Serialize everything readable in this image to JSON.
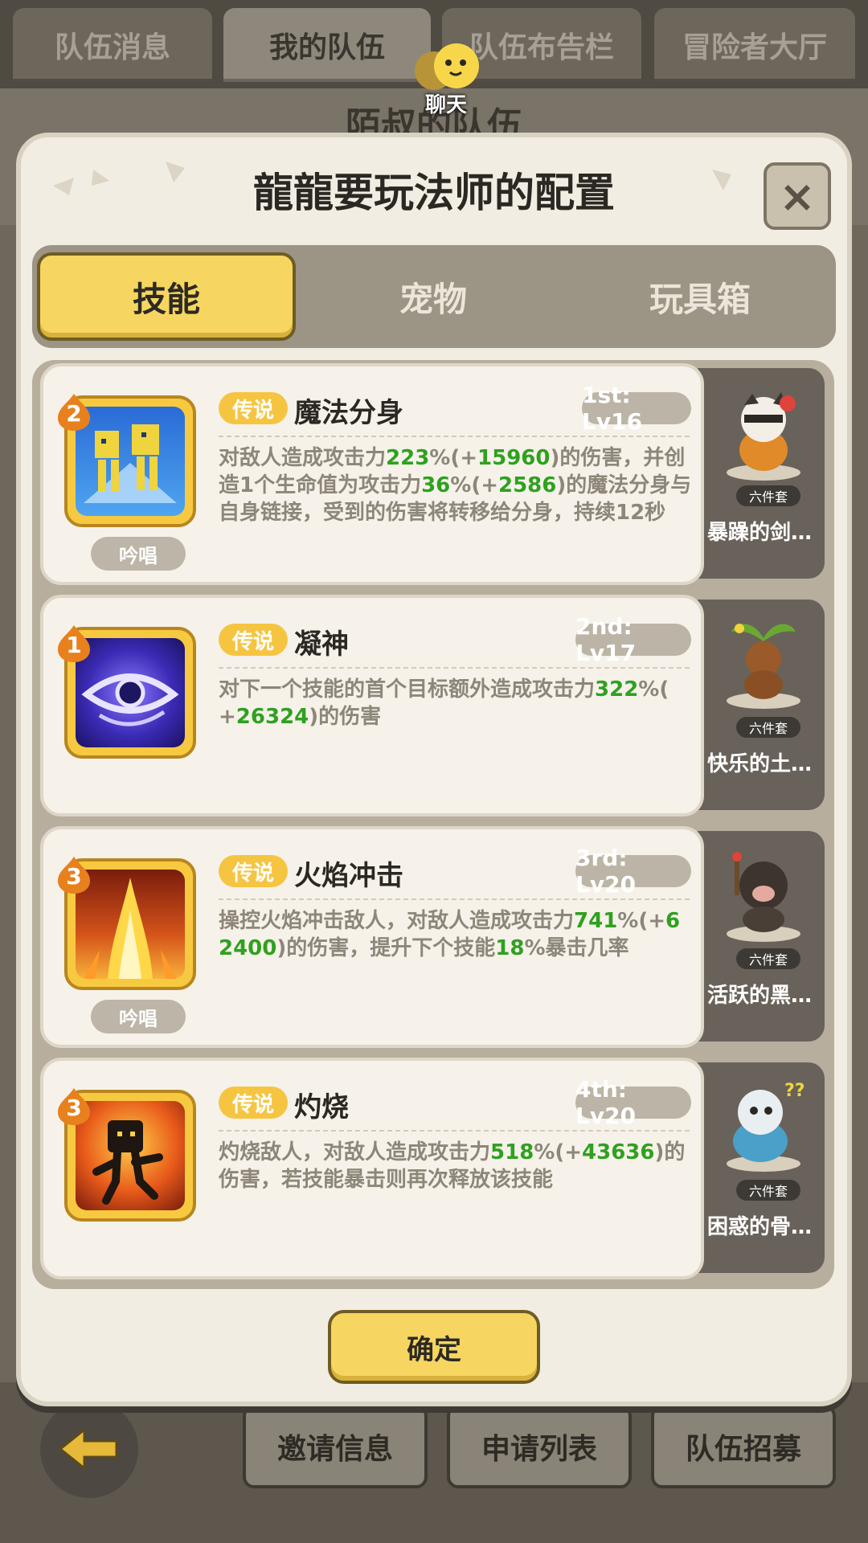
{
  "background": {
    "tabs": [
      {
        "label": "队伍消息",
        "active": false
      },
      {
        "label": "我的队伍",
        "active": true
      },
      {
        "label": "队伍布告栏",
        "active": false
      },
      {
        "label": "冒险者大厅",
        "active": false
      }
    ],
    "chat_label": "聊天",
    "team_title": "陌叔的队伍",
    "bottom_buttons": [
      "邀请信息",
      "申请列表",
      "队伍招募"
    ]
  },
  "modal": {
    "title": "龍龍要玩法师的配置",
    "close_symbol": "×",
    "tabs": [
      {
        "label": "技能",
        "active": true
      },
      {
        "label": "宠物",
        "active": false
      },
      {
        "label": "玩具箱",
        "active": false
      }
    ],
    "confirm_label": "确定"
  },
  "skills": [
    {
      "badge": "2",
      "rarity": "传说",
      "name": "魔法分身",
      "level": "1st: Lv16",
      "cast": "吟唱",
      "desc": [
        [
          "对敌人造成攻击力",
          "223",
          "%(+",
          "15960",
          ")的伤害，并创"
        ],
        [
          "造1个生命值为攻击力",
          "36",
          "%(+",
          "2586",
          ")的魔法分身与"
        ],
        [
          "自身链接，受到的伤害将转移给分身，持续12秒"
        ]
      ],
      "pet_name": "暴躁的剑…",
      "pet_set": "六件套",
      "icon": "magic-clone-icon"
    },
    {
      "badge": "1",
      "rarity": "传说",
      "name": "凝神",
      "level": "2nd: Lv17",
      "cast": "",
      "desc": [
        [
          "对下一个技能的首个目标额外造成攻击力",
          "322",
          "%("
        ],
        [
          "+",
          "26324",
          ")的伤害"
        ]
      ],
      "pet_name": "快乐的土…",
      "pet_set": "六件套",
      "icon": "focus-eye-icon"
    },
    {
      "badge": "3",
      "rarity": "传说",
      "name": "火焰冲击",
      "level": "3rd: Lv20",
      "cast": "吟唱",
      "desc": [
        [
          "操控火焰冲击敌人，对敌人造成攻击力",
          "741",
          "%(+",
          "6"
        ],
        [
          "2400",
          ")的伤害，提升下个技能",
          "18",
          "%暴击几率"
        ]
      ],
      "pet_name": "活跃的黑…",
      "pet_set": "六件套",
      "icon": "flame-strike-icon"
    },
    {
      "badge": "3",
      "rarity": "传说",
      "name": "灼烧",
      "level": "4th: Lv20",
      "cast": "",
      "desc": [
        [
          "灼烧敌人，对敌人造成攻击力",
          "518",
          "%(+",
          "43636",
          ")的"
        ],
        [
          "伤害，若技能暴击则再次释放该技能"
        ]
      ],
      "pet_name": "困惑的骨…",
      "pet_set": "六件套",
      "icon": "burning-figure-icon"
    }
  ]
}
